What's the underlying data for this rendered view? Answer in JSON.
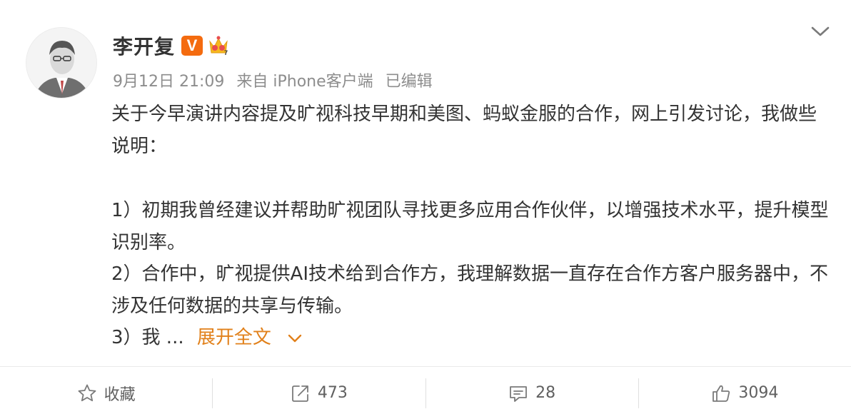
{
  "post": {
    "author": "李开复",
    "verified_badge": "V",
    "meta": {
      "date": "9月12日 21:09",
      "source": "来自 iPhone客户端",
      "edited": "已编辑"
    },
    "paragraphs": [
      "关于今早演讲内容提及旷视科技早期和美图、蚂蚁金服的合作，网上引发讨论，我做些说明：",
      "1）初期我曾经建议并帮助旷视团队寻找更多应用合作伙伴，以增强技术水平，提升模型识别率。",
      "2）合作中，旷视提供AI技术给到合作方，我理解数据一直存在合作方客户服务器中，不涉及任何数据的共享与传输。"
    ],
    "truncated_line": "3）我 ...",
    "expand_label": "展开全文"
  },
  "actions": {
    "favorite": "收藏",
    "repost_count": "473",
    "comment_count": "28",
    "like_count": "3094"
  },
  "colors": {
    "accent": "#e1801a",
    "verified": "#f46b0f",
    "meta_text": "#8d8d8d"
  }
}
